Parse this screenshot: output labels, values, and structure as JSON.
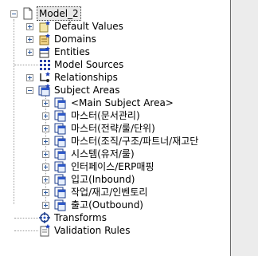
{
  "tree": {
    "root": {
      "label": "Model_2",
      "icon": "document-icon"
    },
    "items": [
      {
        "label": "Default Values",
        "icon": "default-values-icon"
      },
      {
        "label": "Domains",
        "icon": "domains-icon"
      },
      {
        "label": "Entities",
        "icon": "entities-icon"
      },
      {
        "label": "Model Sources",
        "icon": "model-sources-icon"
      },
      {
        "label": "Relationships",
        "icon": "relationships-icon"
      },
      {
        "label": "Subject Areas",
        "icon": "subject-areas-icon"
      },
      {
        "label": "Transforms",
        "icon": "transforms-icon"
      },
      {
        "label": "Validation Rules",
        "icon": "validation-rules-icon"
      }
    ],
    "subject_areas": [
      {
        "label": "<Main Subject Area>"
      },
      {
        "label": "마스터(문서관리)"
      },
      {
        "label": "마스터(전략/룰/단위)"
      },
      {
        "label": "마스터(조직/구조/파트너/재고단"
      },
      {
        "label": "시스템(유저/룰)"
      },
      {
        "label": "인터페이스/ERP매핑"
      },
      {
        "label": "입고(Inbound)"
      },
      {
        "label": "작업/재고/인벤토리"
      },
      {
        "label": "출고(Outbound)"
      }
    ]
  }
}
